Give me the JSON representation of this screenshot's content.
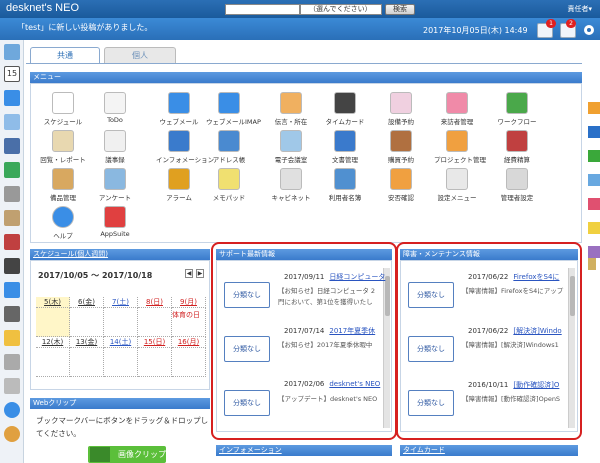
{
  "header": {
    "logo": "desknet's NEO",
    "search_select": "（選んでください）",
    "search_button": "検索",
    "user": "責任者▾"
  },
  "notice": {
    "text": "「test」に新しい投稿がありました。",
    "datetime": "2017年10月05日(木) 14:49",
    "badges": [
      "1",
      "2"
    ]
  },
  "tabs": [
    "共通",
    "個人"
  ],
  "menu": {
    "title": "メニュー",
    "items": [
      {
        "label": "スケジュール",
        "icon": "calendar-icon"
      },
      {
        "label": "ToDo",
        "icon": "todo-icon"
      },
      {
        "label": "ウェブメール",
        "icon": "webmail-icon"
      },
      {
        "label": "ウェブメールIMAP",
        "icon": "webmail-imap-icon"
      },
      {
        "label": "伝言・所在",
        "icon": "message-icon"
      },
      {
        "label": "タイムカード",
        "icon": "timecard-icon"
      },
      {
        "label": "設備予約",
        "icon": "facility-icon"
      },
      {
        "label": "来訪者管理",
        "icon": "visitor-icon"
      },
      {
        "label": "ワークフロー",
        "icon": "workflow-icon"
      },
      {
        "label": "回覧・レポート",
        "icon": "circular-icon"
      },
      {
        "label": "議事録",
        "icon": "minutes-icon"
      },
      {
        "label": "インフォメーション",
        "icon": "information-icon"
      },
      {
        "label": "アドレス帳",
        "icon": "address-icon"
      },
      {
        "label": "電子会議室",
        "icon": "meeting-icon"
      },
      {
        "label": "文書管理",
        "icon": "document-icon"
      },
      {
        "label": "購買予約",
        "icon": "purchase-icon"
      },
      {
        "label": "プロジェクト管理",
        "icon": "project-icon"
      },
      {
        "label": "経費精算",
        "icon": "expense-icon"
      },
      {
        "label": "備品管理",
        "icon": "equipment-icon"
      },
      {
        "label": "アンケート",
        "icon": "survey-icon"
      },
      {
        "label": "アラーム",
        "icon": "alarm-icon"
      },
      {
        "label": "メモパッド",
        "icon": "memo-icon"
      },
      {
        "label": "キャビネット",
        "icon": "cabinet-icon"
      },
      {
        "label": "利用者名簿",
        "icon": "userlist-icon"
      },
      {
        "label": "安否確認",
        "icon": "safety-icon"
      },
      {
        "label": "設定メニュー",
        "icon": "settings-icon"
      },
      {
        "label": "管理者設定",
        "icon": "admin-icon"
      },
      {
        "label": "ヘルプ",
        "icon": "help-icon"
      },
      {
        "label": "AppSuite",
        "icon": "appsuite-icon"
      }
    ]
  },
  "schedule": {
    "title": "スケジュール(個人週間)",
    "range": "2017/10/05 ～ 2017/10/18",
    "week1": [
      "5(木)",
      "6(金)",
      "7(土)",
      "8(日)",
      "9(月)"
    ],
    "week2": [
      "12(木)",
      "13(金)",
      "14(土)",
      "15(日)",
      "16(月)"
    ],
    "holiday_note": "体育の日"
  },
  "support": {
    "title": "サポート最新情報",
    "items": [
      {
        "category": "分類なし",
        "date": "2017/09/11",
        "title": "日経コンピュータ",
        "summary": "【お知らせ】日経コンピュータ 2",
        "summary2": "門において、第1位を獲得いたし"
      },
      {
        "category": "分類なし",
        "date": "2017/07/14",
        "title": "2017年夏季休",
        "summary": "【お知らせ】2017年夏季休暇中"
      },
      {
        "category": "分類なし",
        "date": "2017/02/06",
        "title": "desknet's NEO",
        "summary": "【アップデート】desknet's NEO"
      }
    ]
  },
  "maintenance": {
    "title": "障害・メンテナンス情報",
    "items": [
      {
        "category": "分類なし",
        "date": "2017/06/22",
        "title": "FirefoxをS4に",
        "summary": "【障害情報】FirefoxをS4にアップ"
      },
      {
        "category": "分類なし",
        "date": "2017/06/22",
        "title": "[解決済]Windo",
        "summary": "【障害情報】[解決済]Windows1"
      },
      {
        "category": "分類なし",
        "date": "2016/10/11",
        "title": "[動作確認済]O",
        "summary": "【障害情報】[動作確認済]OpenS"
      }
    ]
  },
  "webclip": {
    "title": "Webクリップ",
    "text1": "ブックマークバーにボタンをドラッグ＆ドロップし",
    "text2": "てください。",
    "button": "画像クリップ"
  },
  "bottom_panels": [
    "インフォメーション",
    "タイムカード"
  ]
}
